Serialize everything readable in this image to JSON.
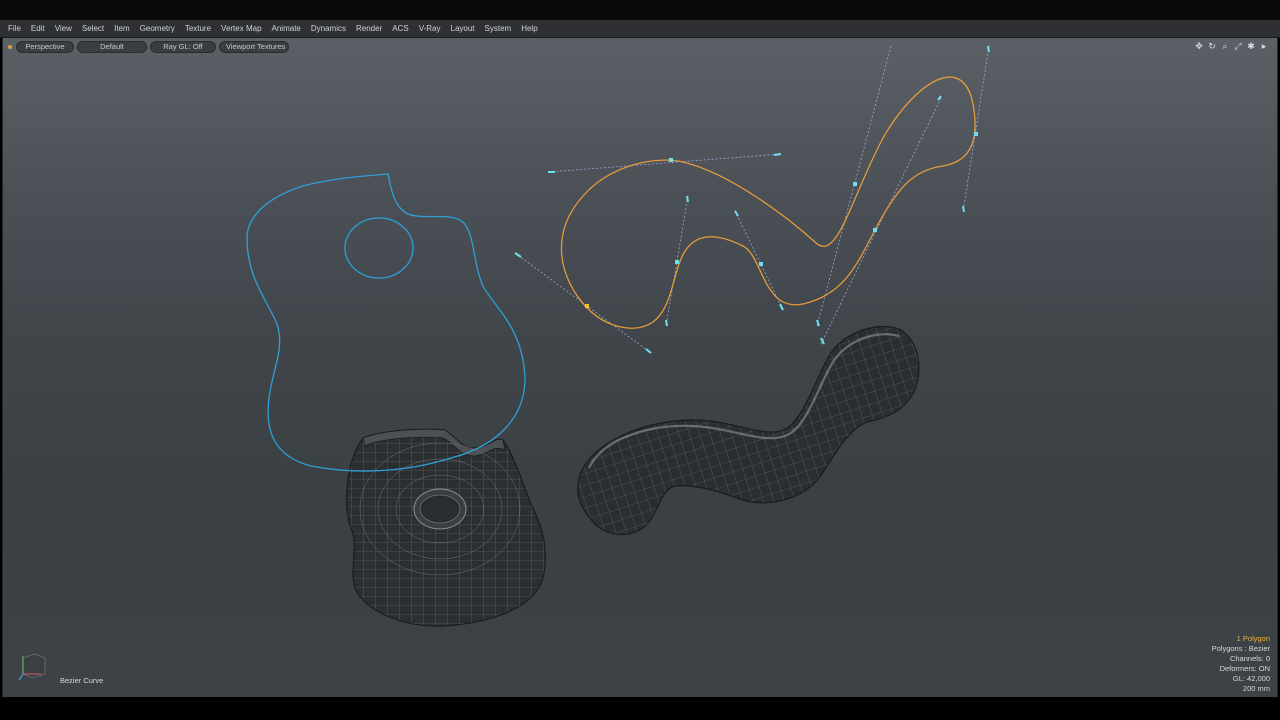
{
  "menu": [
    "File",
    "Edit",
    "View",
    "Select",
    "Item",
    "Geometry",
    "Texture",
    "Vertex Map",
    "Animate",
    "Dynamics",
    "Render",
    "ACS",
    "V-Ray",
    "Layout",
    "System",
    "Help"
  ],
  "viewport": {
    "view_mode": "Perspective",
    "shading": "Default",
    "raygl": "Ray GL: Off",
    "textures": "Viewport Textures",
    "tools": [
      "move-icon",
      "rotate-icon",
      "zoom-icon",
      "fit-icon",
      "settings-icon",
      "expand-icon"
    ]
  },
  "info": {
    "selection": "1 Polygon",
    "polygons": "Polygons : Bezier",
    "channels": "Channels: 0",
    "deformers": "Deformers: ON",
    "gl": "GL: 42,000",
    "grid": "200 mm"
  },
  "status": {
    "item_label": "Bezier Curve"
  },
  "colors": {
    "guitar_curve": "#2f9fd8",
    "bezier_curve": "#e39a3c",
    "handles": "#6fe0f0",
    "mesh_fill": "#2c2f32",
    "mesh_wire": "#6d7276"
  }
}
